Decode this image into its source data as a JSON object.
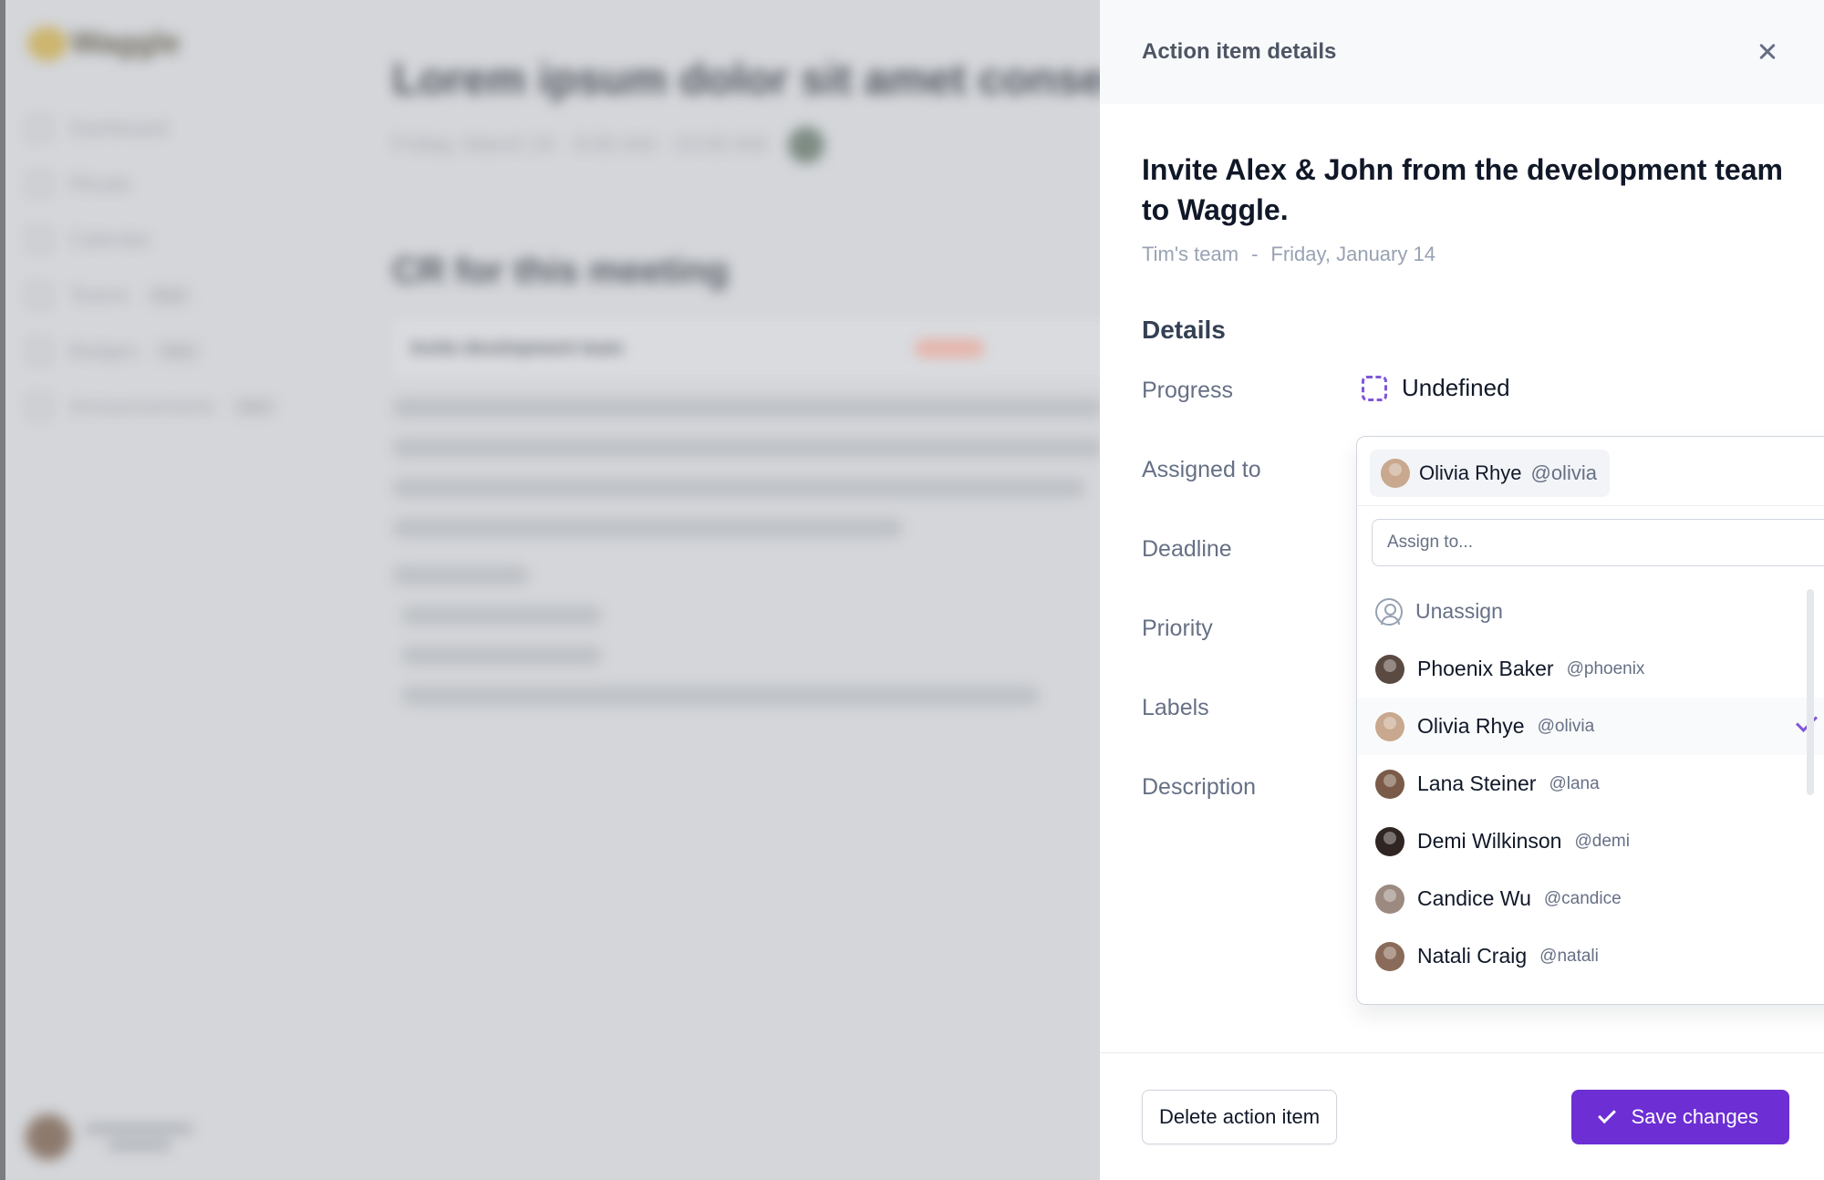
{
  "panel": {
    "header_title": "Action item details",
    "item_title": "Invite Alex & John from the development team to Waggle.",
    "team": "Tim's team",
    "separator": "-",
    "date": "Friday, January 14",
    "details_heading": "Details",
    "fields": {
      "progress": "Progress",
      "assigned_to": "Assigned to",
      "deadline": "Deadline",
      "priority": "Priority",
      "labels": "Labels",
      "description": "Description"
    },
    "progress_value": "Undefined"
  },
  "assignee": {
    "current_name": "Olivia Rhye",
    "current_handle": "@olivia",
    "search_placeholder": "Assign to...",
    "unassign_label": "Unassign",
    "options": [
      {
        "name": "Phoenix Baker",
        "handle": "@phoenix",
        "color": "#5b4a42"
      },
      {
        "name": "Olivia Rhye",
        "handle": "@olivia",
        "color": "#c8a88e",
        "selected": true
      },
      {
        "name": "Lana Steiner",
        "handle": "@lana",
        "color": "#7a5a48"
      },
      {
        "name": "Demi Wilkinson",
        "handle": "@demi",
        "color": "#2f2522"
      },
      {
        "name": "Candice Wu",
        "handle": "@candice",
        "color": "#9c8a80"
      },
      {
        "name": "Natali Craig",
        "handle": "@natali",
        "color": "#8a6a58"
      }
    ]
  },
  "footer": {
    "delete_label": "Delete action item",
    "save_label": "Save changes"
  },
  "colors": {
    "accent": "#7f56d9",
    "primary_button": "#6d2ed4"
  }
}
